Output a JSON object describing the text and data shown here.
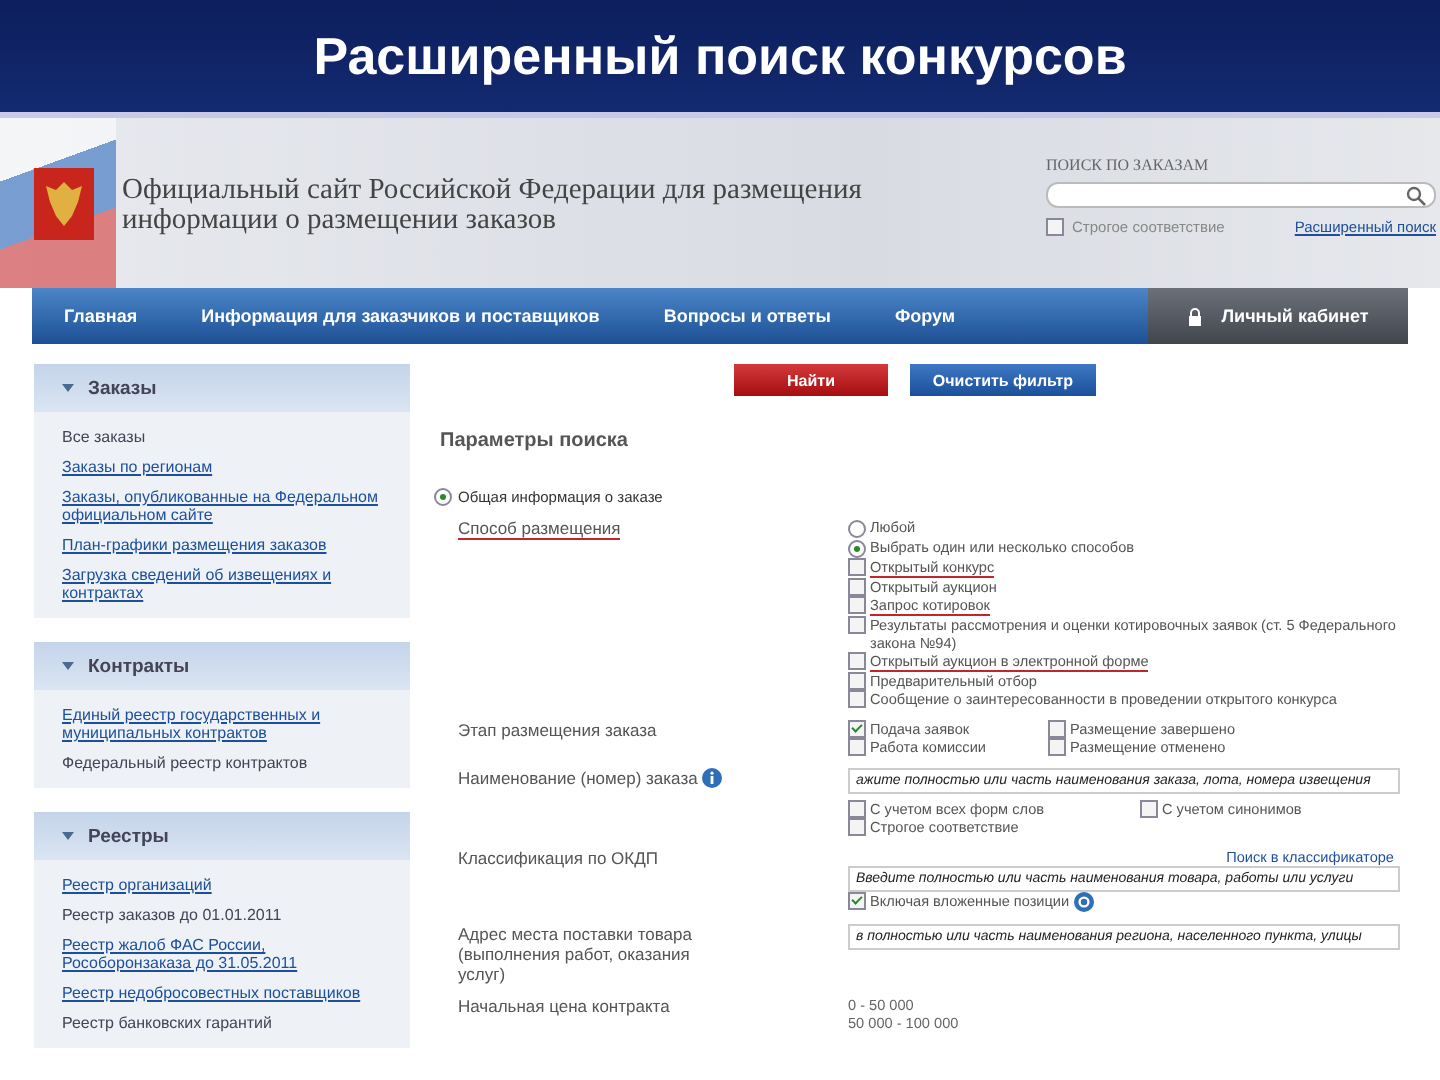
{
  "slide_title": "Расширенный поиск конкурсов",
  "header": {
    "site_title": "Официальный сайт Российской Федерации для размещения информации о размещении заказов",
    "search_label": "ПОИСК ПО ЗАКАЗАМ",
    "strict_match": {
      "label": "Строгое соответствие",
      "checked": false
    },
    "advanced_link": "Расширенный поиск"
  },
  "nav": {
    "items": [
      {
        "label": "Главная"
      },
      {
        "label": "Информация для заказчиков и поставщиков"
      },
      {
        "label": "Вопросы и ответы"
      },
      {
        "label": "Форум"
      }
    ],
    "cabinet": "Личный кабинет"
  },
  "sidebar": [
    {
      "title": "Заказы",
      "expanded": true,
      "items": [
        {
          "text": "Все заказы",
          "link": false
        },
        {
          "text": "Заказы по регионам",
          "link": true
        },
        {
          "text": "Заказы, опубликованные на Федеральном официальном сайте",
          "link": true
        },
        {
          "text": "План-графики размещения заказов",
          "link": true
        },
        {
          "text": "Загрузка сведений об извещениях и контрактах",
          "link": true
        }
      ]
    },
    {
      "title": "Контракты",
      "expanded": true,
      "items": [
        {
          "text": "Единый реестр государственных и муниципальных контрактов",
          "link": true
        },
        {
          "text": "Федеральный реестр контрактов",
          "link": false
        }
      ]
    },
    {
      "title": "Реестры",
      "expanded": true,
      "items": [
        {
          "text": "Реестр организаций",
          "link": true
        },
        {
          "text": "Реестр заказов до 01.01.2011",
          "link": false
        },
        {
          "text": "Реестр жалоб ФАС России, Рособоронзаказа до 31.05.2011",
          "link": true
        },
        {
          "text": "Реестр недобросовестных поставщиков",
          "link": true
        },
        {
          "text": "Реестр банковских гарантий",
          "link": false
        }
      ]
    }
  ],
  "buttons": {
    "find": "Найти",
    "clear": "Очистить фильтр"
  },
  "params_title": "Параметры поиска",
  "general": {
    "label": "Общая информация о заказе",
    "selected": true
  },
  "method": {
    "label": "Способ размещения",
    "highlighted": true,
    "radios": [
      {
        "label": "Любой",
        "selected": false
      },
      {
        "label": "Выбрать один или несколько способов",
        "selected": true
      }
    ],
    "options": [
      {
        "label": "Открытый конкурс",
        "checked": false,
        "highlighted": true
      },
      {
        "label": "Открытый аукцион",
        "checked": false,
        "highlighted": false
      },
      {
        "label": "Запрос котировок",
        "checked": false,
        "highlighted": true
      },
      {
        "label": "Результаты рассмотрения и оценки котировочных заявок (ст. 5 Федерального закона №94)",
        "checked": false,
        "highlighted": false
      },
      {
        "label": "Открытый аукцион в электронной форме",
        "checked": false,
        "highlighted": true
      },
      {
        "label": "Предварительный отбор",
        "checked": false,
        "highlighted": false
      },
      {
        "label": "Сообщение о заинтересованности в проведении открытого конкурса",
        "checked": false,
        "highlighted": false
      }
    ]
  },
  "stage": {
    "label": "Этап размещения заказа",
    "options": [
      {
        "label": "Подача заявок",
        "checked": true
      },
      {
        "label": "Размещение завершено",
        "checked": false
      },
      {
        "label": "Работа комиссии",
        "checked": false
      },
      {
        "label": "Размещение отменено",
        "checked": false
      }
    ]
  },
  "name": {
    "label": "Наименование (номер) заказа",
    "value": "ажите полностью или часть наименования заказа, лота, номера извещения",
    "options": [
      {
        "label": "С учетом всех форм слов",
        "checked": false
      },
      {
        "label": "С учетом синонимов",
        "checked": false
      },
      {
        "label": "Строгое соответствие",
        "checked": false
      }
    ]
  },
  "okdp": {
    "label": "Классификация по ОКДП",
    "link": "Поиск в классификаторе",
    "value": "Введите полностью или часть наименования товара, работы или услуги",
    "nested": {
      "label": "Включая вложенные позиции",
      "checked": true
    }
  },
  "address": {
    "label": "Адрес места поставки товара (выполнения работ, оказания услуг)",
    "value": "в полностью или часть наименования региона, населенного пункта, улицы"
  },
  "price": {
    "label": "Начальная цена контракта",
    "ranges": [
      "0 - 50 000",
      "50 000 - 100 000"
    ]
  }
}
